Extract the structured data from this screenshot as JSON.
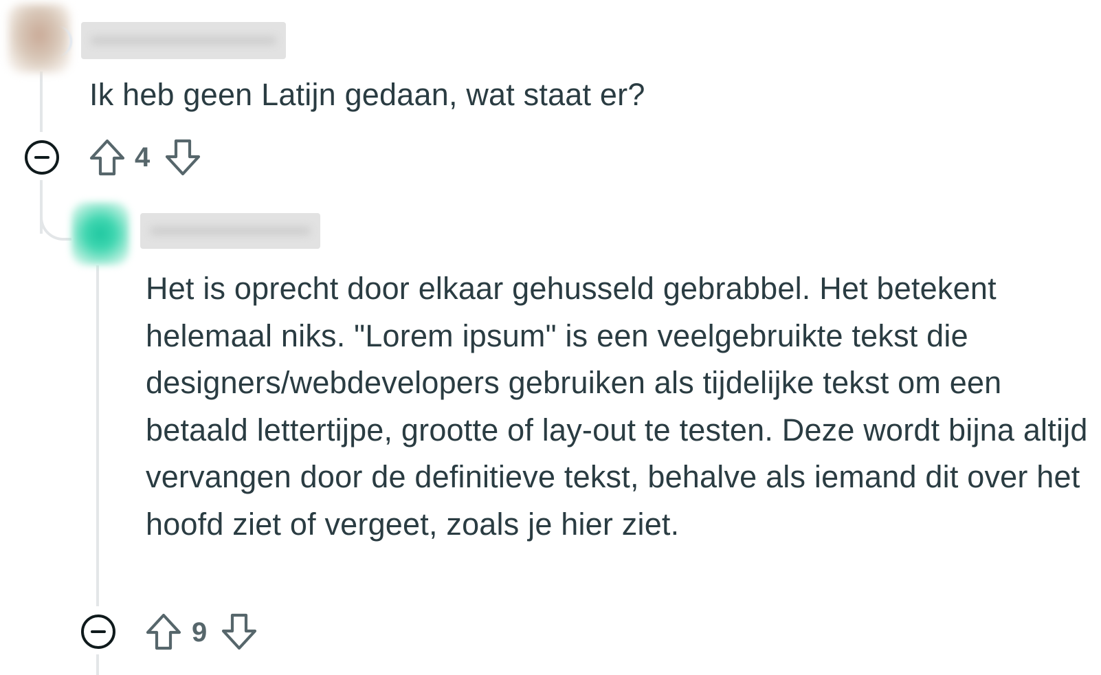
{
  "thread": {
    "comments": [
      {
        "text": "Ik heb geen Latijn gedaan, wat staat er?",
        "score": "4"
      },
      {
        "text": "Het is oprecht door elkaar gehusseld gebrabbel. Het betekent helemaal niks. \"Lorem ipsum\" is een veelgebruikte tekst die designers/webdevelopers gebruiken als tijdelijke tekst om een betaald lettertijpe, grootte of lay-out te testen. Deze wordt bijna altijd vervangen door de definitieve tekst, behalve als iemand dit over het hoofd ziet of vergeet, zoals je hier ziet.",
        "score": "9"
      }
    ]
  },
  "icons": {
    "collapse": "collapse-minus-icon",
    "upvote": "upvote-arrow-icon",
    "downvote": "downvote-arrow-icon"
  },
  "colors": {
    "text": "#2a3c42",
    "vote_count": "#56666b",
    "thread_line": "#e3e6e8",
    "icon": "#0f1a1c"
  }
}
